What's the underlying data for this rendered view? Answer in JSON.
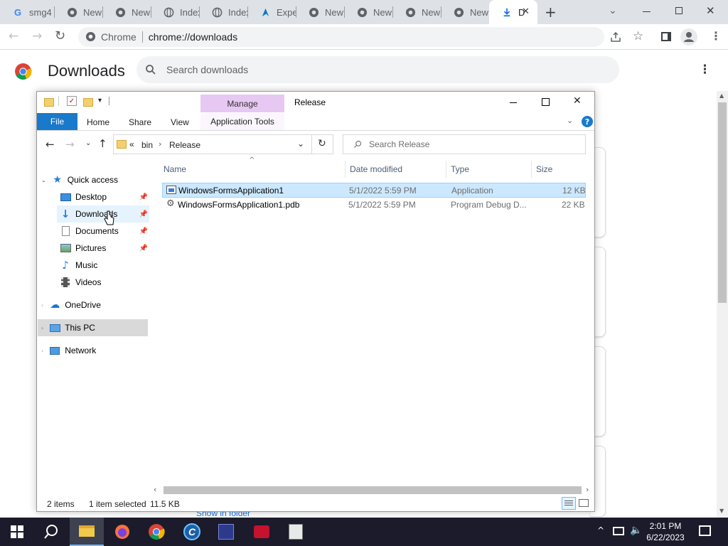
{
  "tabs": [
    {
      "label": "smg4",
      "icon": "google-g-icon"
    },
    {
      "label": "New",
      "icon": "chrome-icon"
    },
    {
      "label": "New",
      "icon": "chrome-icon"
    },
    {
      "label": "Index",
      "icon": "globe-icon"
    },
    {
      "label": "Index",
      "icon": "globe-icon"
    },
    {
      "label": "Expe",
      "icon": "azure-icon"
    },
    {
      "label": "New",
      "icon": "chrome-icon"
    },
    {
      "label": "New",
      "icon": "chrome-icon"
    },
    {
      "label": "New",
      "icon": "chrome-icon"
    },
    {
      "label": "New",
      "icon": "chrome-icon"
    },
    {
      "label": "D",
      "icon": "download-icon",
      "active": true
    }
  ],
  "omnibox": {
    "site": "Chrome",
    "url": "chrome://downloads"
  },
  "downloads_page": {
    "title": "Downloads",
    "search_placeholder": "Search downloads",
    "show_in_folder": "Show in folder"
  },
  "explorer": {
    "qat_title": "Release",
    "ribbon": {
      "manage_tab": "Manage",
      "tabs": [
        "File",
        "Home",
        "Share",
        "View",
        "Application Tools"
      ]
    },
    "address": {
      "prefix": "«",
      "crumbs": [
        "bin",
        "Release"
      ]
    },
    "search_placeholder": "Search Release",
    "nav": {
      "quick_access": "Quick access",
      "quick_items": [
        "Desktop",
        "Downloads",
        "Documents",
        "Pictures",
        "Music",
        "Videos"
      ],
      "onedrive": "OneDrive",
      "this_pc": "This PC",
      "network": "Network"
    },
    "columns": [
      "Name",
      "Date modified",
      "Type",
      "Size"
    ],
    "files": [
      {
        "name": "WindowsFormsApplication1",
        "date": "5/1/2022 5:59 PM",
        "type": "Application",
        "size": "12 KB",
        "selected": true
      },
      {
        "name": "WindowsFormsApplication1.pdb",
        "date": "5/1/2022 5:59 PM",
        "type": "Program Debug D...",
        "size": "22 KB",
        "selected": false
      }
    ],
    "status": {
      "count": "2 items",
      "selected": "1 item selected",
      "size": "11.5 KB"
    }
  },
  "taskbar": {
    "time": "2:01 PM",
    "date": "6/22/2023"
  },
  "colors": {
    "accent": "#1a73e8",
    "selection": "#cce8ff",
    "manage_tab": "#e6c8f2",
    "file_tab": "#1979ca",
    "taskbar": "#1b1b2b"
  }
}
